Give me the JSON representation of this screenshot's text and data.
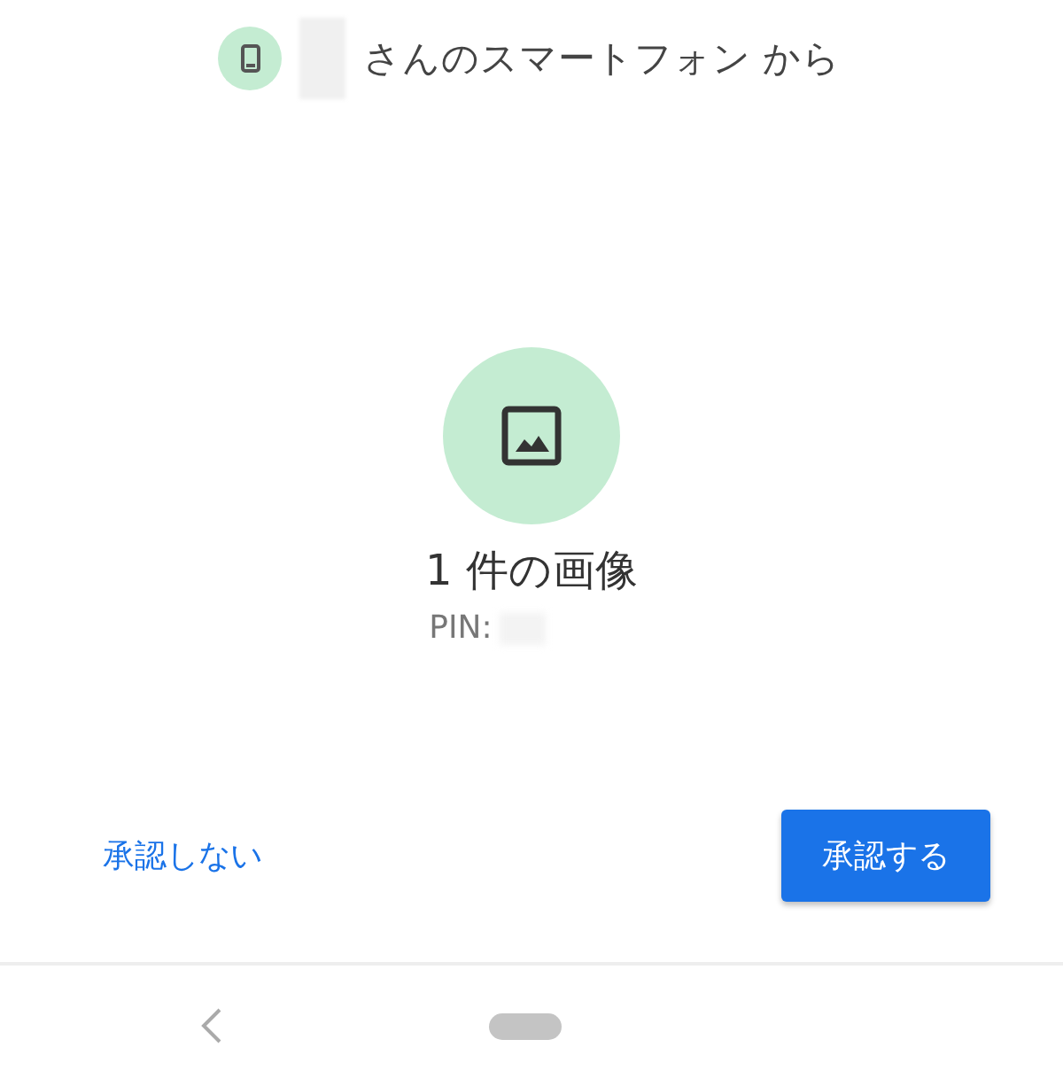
{
  "header": {
    "sender_suffix": "さんのスマートフォン から"
  },
  "transfer": {
    "title": "1 件の画像",
    "pin_label": "PIN:"
  },
  "buttons": [
    {
      "label": "承認しない",
      "kind": "text"
    },
    {
      "label": "承認する",
      "kind": "filled"
    }
  ]
}
